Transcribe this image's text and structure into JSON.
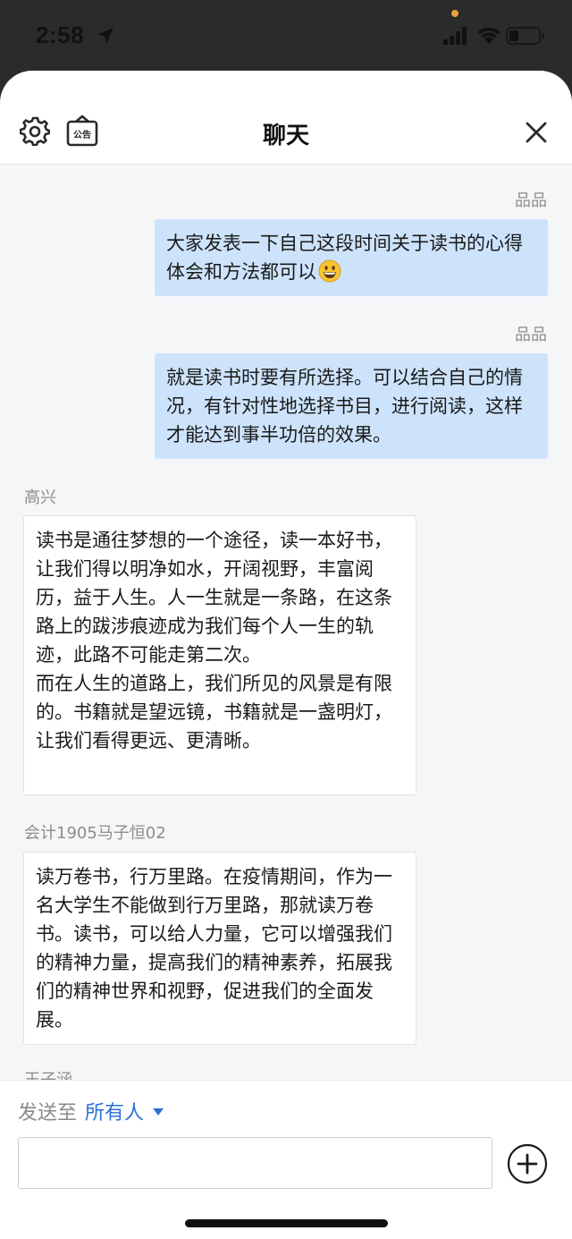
{
  "status_bar": {
    "time": "2:58"
  },
  "header": {
    "title": "聊天"
  },
  "messages": [
    {
      "sender": "品品",
      "side": "right",
      "text": "大家发表一下自己这段时间关于读书的心得体会和方法都可以",
      "emoji": "grinning-face"
    },
    {
      "sender": "品品",
      "side": "right",
      "text": "就是读书时要有所选择。可以结合自己的情况，有针对性地选择书目，进行阅读，这样才能达到事半功倍的效果。"
    },
    {
      "sender": "高兴",
      "side": "left",
      "text": "读书是通往梦想的一个途径，读一本好书，让我们得以明净如水，开阔视野，丰富阅历，益于人生。人一生就是一条路，在这条路上的跋涉痕迹成为我们每个人一生的轨迹，此路不可能走第二次。\n而在人生的道路上，我们所见的风景是有限的。书籍就是望远镜，书籍就是一盏明灯，让我们看得更远、更清晰。"
    },
    {
      "sender": "会计1905马子恒02",
      "side": "left",
      "text": "读万卷书，行万里路。在疫情期间，作为一名大学生不能做到行万里路，那就读万卷书。读书，可以给人力量，它可以增强我们的精神力量，提高我们的精神素养，拓展我们的精神世界和视野，促进我们的全面发展。"
    },
    {
      "sender": "王子涵",
      "side": "left",
      "text": ""
    }
  ],
  "footer": {
    "send_to_label": "发送至",
    "recipient": "所有人",
    "input_value": "",
    "input_placeholder": ""
  },
  "icons": {
    "settings": "gear-icon",
    "notice": "announcement-icon",
    "close": "close-icon",
    "add": "plus-circle-icon"
  },
  "colors": {
    "my_bubble": "#cde3fb",
    "accent": "#2a72d6"
  }
}
